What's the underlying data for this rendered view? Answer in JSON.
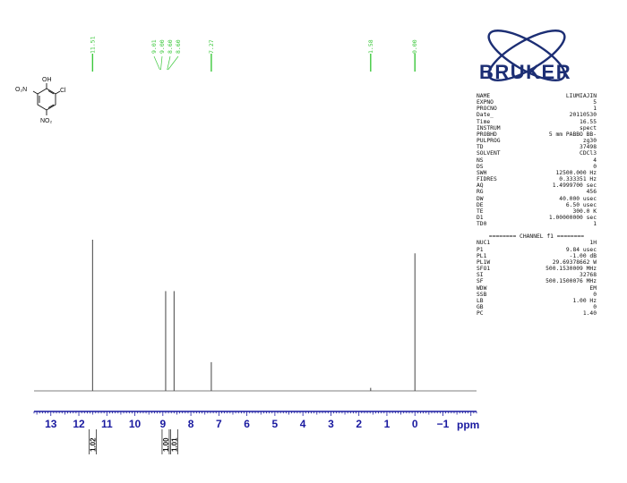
{
  "chart_data": {
    "type": "line",
    "xlabel": "ppm",
    "xlim": [
      13.6,
      -2.2
    ],
    "x_ticks": [
      13,
      12,
      11,
      10,
      9,
      8,
      7,
      6,
      5,
      4,
      3,
      2,
      1,
      0,
      -1
    ],
    "x_tick_labels": [
      "13",
      "12",
      "11",
      "10",
      "9",
      "8",
      "7",
      "6",
      "5",
      "4",
      "3",
      "2",
      "1",
      "0",
      "−1"
    ],
    "peaks": [
      {
        "ppm": 11.51,
        "height": 1.0
      },
      {
        "ppm": 8.9,
        "height": 0.66
      },
      {
        "ppm": 8.6,
        "height": 0.66
      },
      {
        "ppm": 7.27,
        "height": 0.19
      },
      {
        "ppm": 1.58,
        "height": 0.02
      },
      {
        "ppm": 0.0,
        "height": 0.91
      }
    ],
    "peak_labels": [
      {
        "ppm": 11.51,
        "text": "11.51"
      },
      {
        "ppm": 9.01,
        "text": "9.01"
      },
      {
        "ppm": 8.98,
        "text": "9.00"
      },
      {
        "ppm": 8.94,
        "text": "8.60"
      },
      {
        "ppm": 8.91,
        "text": "8.60"
      },
      {
        "ppm": 7.27,
        "text": "7.27"
      },
      {
        "ppm": 1.58,
        "text": "1.58"
      },
      {
        "ppm": 0.0,
        "text": "0.00"
      }
    ],
    "integrals": [
      {
        "ppm": 11.51,
        "value": "1.02"
      },
      {
        "ppm": 8.9,
        "value": "1.00"
      },
      {
        "ppm": 8.6,
        "value": "1.01"
      }
    ]
  },
  "molecule": {
    "oh": "OH",
    "cl": "Cl",
    "no2_left": "O₂N",
    "no2_bottom": "NO₂"
  },
  "logo": {
    "text": "BRUKER",
    "color": "#1c2e74"
  },
  "acquisition_params": [
    {
      "key": "NAME",
      "value": "LIUMIAJIN",
      "unit": ""
    },
    {
      "key": "EXPNO",
      "value": "5",
      "unit": ""
    },
    {
      "key": "PROCNO",
      "value": "1",
      "unit": ""
    },
    {
      "key": "Date_",
      "value": "20110530",
      "unit": ""
    },
    {
      "key": "Time",
      "value": "16.55",
      "unit": ""
    },
    {
      "key": "INSTRUM",
      "value": "spect",
      "unit": ""
    },
    {
      "key": "PROBHD",
      "value": "5 mm PABBO BB-",
      "unit": ""
    },
    {
      "key": "PULPROG",
      "value": "zg30",
      "unit": ""
    },
    {
      "key": "TD",
      "value": "37498",
      "unit": ""
    },
    {
      "key": "SOLVENT",
      "value": "CDCl3",
      "unit": ""
    },
    {
      "key": "NS",
      "value": "4",
      "unit": ""
    },
    {
      "key": "DS",
      "value": "0",
      "unit": ""
    },
    {
      "key": "SWH",
      "value": "12500.000",
      "unit": "Hz"
    },
    {
      "key": "FIDRES",
      "value": "0.333351",
      "unit": "Hz"
    },
    {
      "key": "AQ",
      "value": "1.4999700",
      "unit": "sec"
    },
    {
      "key": "RG",
      "value": "456",
      "unit": ""
    },
    {
      "key": "DW",
      "value": "40.000",
      "unit": "usec"
    },
    {
      "key": "DE",
      "value": "6.50",
      "unit": "usec"
    },
    {
      "key": "TE",
      "value": "300.0",
      "unit": "K"
    },
    {
      "key": "D1",
      "value": "1.00000000",
      "unit": "sec"
    },
    {
      "key": "TD0",
      "value": "1",
      "unit": ""
    }
  ],
  "channel_header": "======== CHANNEL f1 ========",
  "channel_params": [
    {
      "key": "NUC1",
      "value": "1H",
      "unit": ""
    },
    {
      "key": "P1",
      "value": "9.84",
      "unit": "usec"
    },
    {
      "key": "PL1",
      "value": "-1.00",
      "unit": "dB"
    },
    {
      "key": "PL1W",
      "value": "29.69378662",
      "unit": "W"
    },
    {
      "key": "SFO1",
      "value": "500.1530009",
      "unit": "MHz"
    },
    {
      "key": "SI",
      "value": "32768",
      "unit": ""
    },
    {
      "key": "SF",
      "value": "500.1500076",
      "unit": "MHz"
    },
    {
      "key": "WDW",
      "value": "EM",
      "unit": ""
    },
    {
      "key": "SSB",
      "value": "0",
      "unit": ""
    },
    {
      "key": "LB",
      "value": "1.00",
      "unit": "Hz"
    },
    {
      "key": "GB",
      "value": "0",
      "unit": ""
    },
    {
      "key": "PC",
      "value": "1.40",
      "unit": ""
    }
  ]
}
